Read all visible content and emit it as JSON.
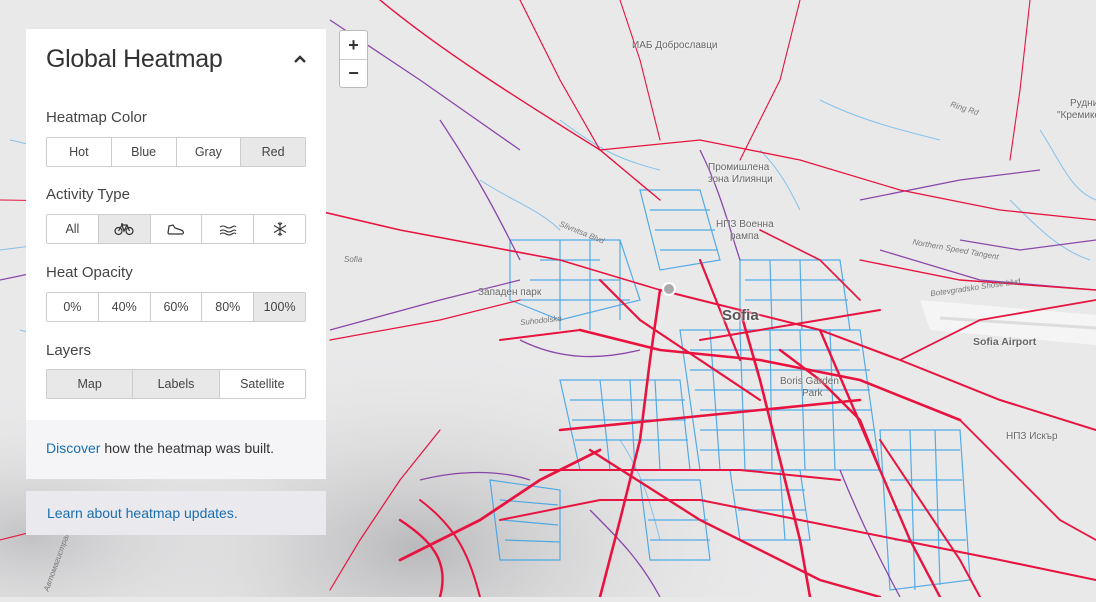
{
  "panel": {
    "title": "Global Heatmap",
    "collapse_icon": "chevron-up-icon",
    "heatmap_color": {
      "label": "Heatmap Color",
      "options": [
        "Hot",
        "Blue",
        "Gray",
        "Red"
      ],
      "selected": "Red"
    },
    "activity_type": {
      "label": "Activity Type",
      "options": [
        {
          "text": "All"
        },
        {
          "icon": "bike-icon"
        },
        {
          "icon": "shoe-icon"
        },
        {
          "icon": "water-icon"
        },
        {
          "icon": "snowflake-icon"
        }
      ],
      "selected_index": 1
    },
    "heat_opacity": {
      "label": "Heat Opacity",
      "options": [
        "0%",
        "40%",
        "60%",
        "80%",
        "100%"
      ],
      "selected": "100%"
    },
    "layers": {
      "label": "Layers",
      "options": [
        "Map",
        "Labels",
        "Satellite"
      ],
      "selected": [
        "Map",
        "Labels"
      ]
    },
    "discover": {
      "link": "Discover",
      "text": " how the heatmap was built."
    }
  },
  "updates_link": "Learn about heatmap updates.",
  "zoom": {
    "in": "+",
    "out": "−"
  },
  "map": {
    "colors": {
      "background": "#e9e9ea",
      "heat_red": "#e8133e",
      "heat_purple": "#7a2c9e",
      "heat_blue": "#3aa0e6",
      "water": "#8fc9ef"
    },
    "labels": {
      "sofia": "Sofia",
      "sofia_airport": "Sofia Airport",
      "iab": "ИАБ Доброславци",
      "prom_1": "Промишлена",
      "prom_2": "зона Илиянци",
      "npz_1": "НПЗ Военна",
      "npz_2": "рампа",
      "zapaden": "Западен парк",
      "borisova_1": "Boris Garden",
      "borisova_2": "Park",
      "npz_iskar": "НПЗ Искър",
      "rudnik_1": "Рудни",
      "rudnik_2": "\"Кремико",
      "sofia_road": "Sofia",
      "ring_rd": "Ring Rd",
      "northern": "Northern Speed Tangent",
      "botevgradsko": "Botevgradsko Shose blvd",
      "suhodolska": "Suhodolska",
      "slivnitsa": "Slivnitsa Blvd",
      "avtomagistrala": "Автомагистрала"
    }
  }
}
